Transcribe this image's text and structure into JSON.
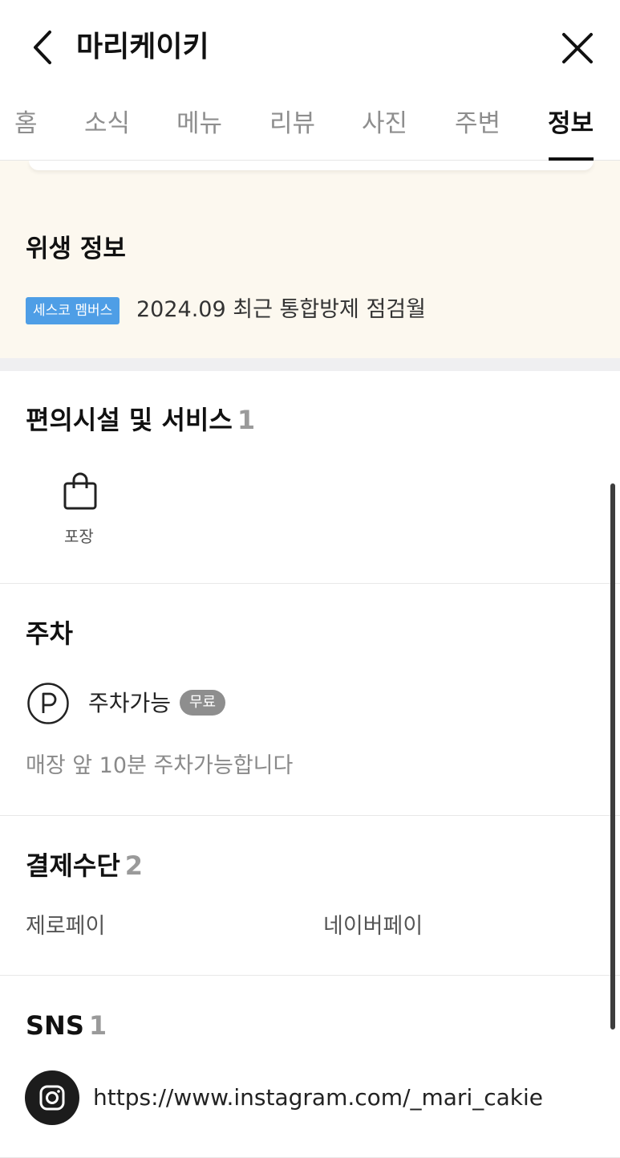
{
  "header": {
    "title": "마리케이키"
  },
  "tabs": [
    {
      "label": "홈"
    },
    {
      "label": "소식"
    },
    {
      "label": "메뉴"
    },
    {
      "label": "리뷰"
    },
    {
      "label": "사진"
    },
    {
      "label": "주변"
    },
    {
      "label": "정보",
      "active": true
    }
  ],
  "hygiene": {
    "title": "위생 정보",
    "badge": "세스코 멤버스",
    "text": "2024.09 최근 통합방제 점검월"
  },
  "facilities": {
    "title": "편의시설 및 서비스",
    "count": "1",
    "items": [
      {
        "label": "포장",
        "icon": "shopping-bag-icon"
      }
    ]
  },
  "parking": {
    "title": "주차",
    "icon": "parking-icon",
    "status": "주차가능",
    "badge": "무료",
    "note": "매장 앞 10분 주차가능합니다"
  },
  "payment": {
    "title": "결제수단",
    "count": "2",
    "items": [
      "제로페이",
      "네이버페이"
    ]
  },
  "sns": {
    "title": "SNS",
    "count": "1",
    "icon": "instagram-icon",
    "link": "https://www.instagram.com/_mari_cakie"
  },
  "colors": {
    "accent_blue": "#4e9ee6",
    "hygiene_bg": "#fcf8ef",
    "badge_gray": "#8e8e8e"
  }
}
